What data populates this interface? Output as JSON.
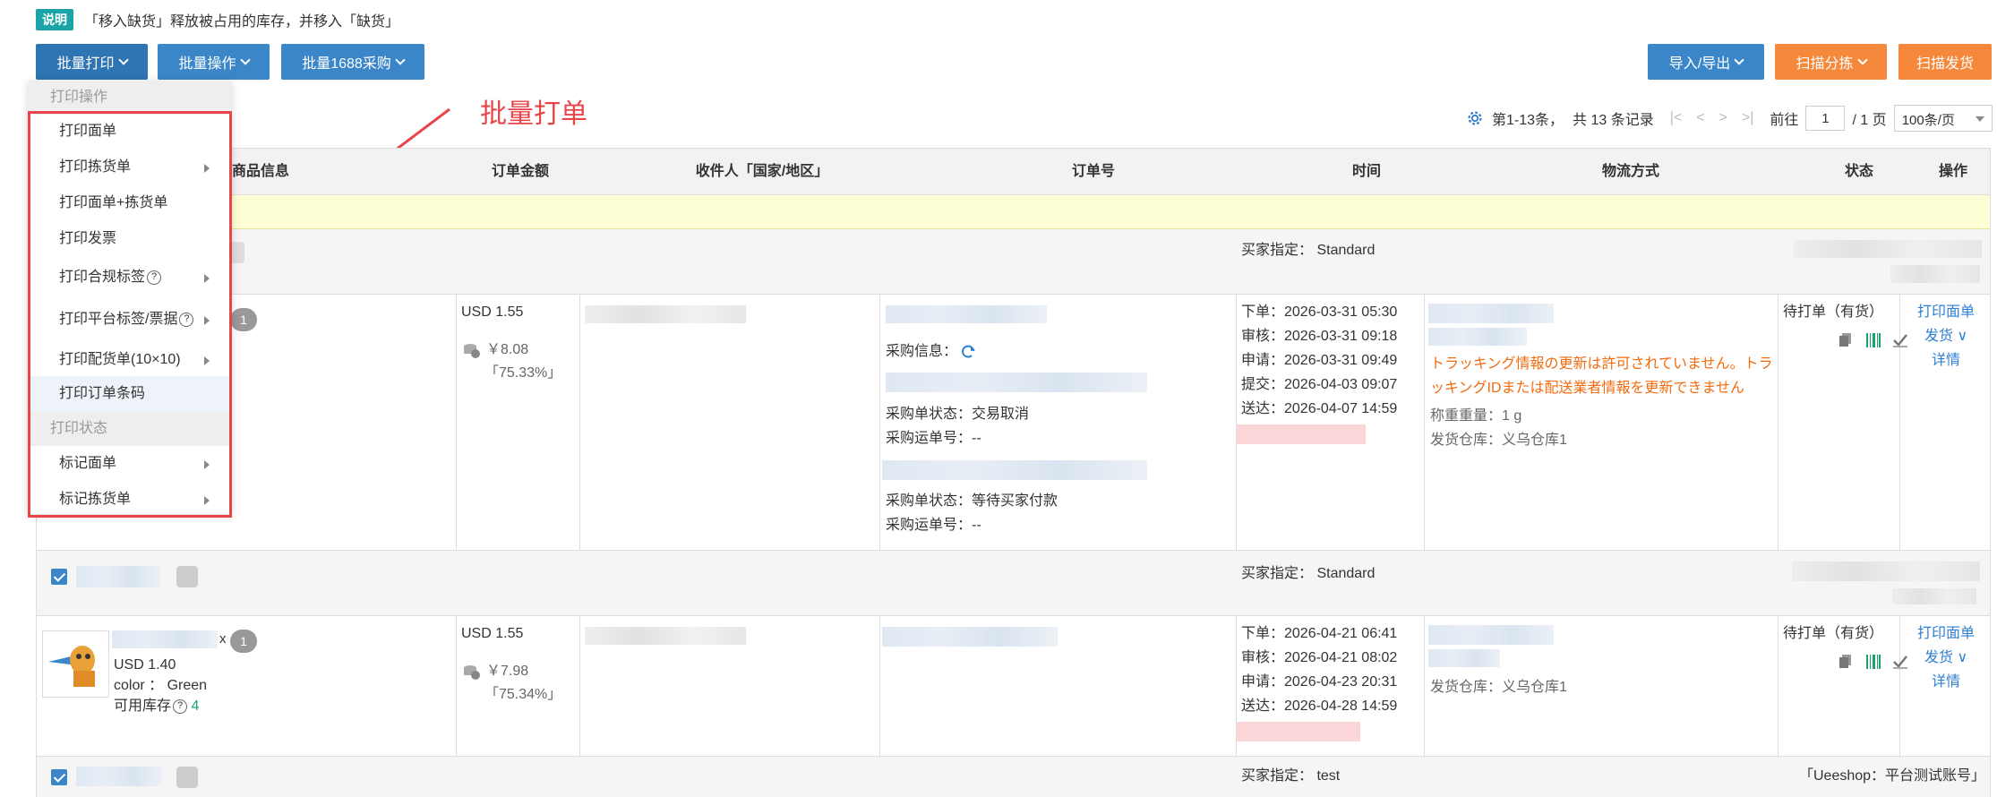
{
  "notice": {
    "tag": "说明",
    "text": "「移入缺货」释放被占用的库存，并移入「缺货」"
  },
  "toolbar": {
    "batch_print": "批量打印",
    "batch_ops": "批量操作",
    "batch_1688": "批量1688采购",
    "import_export": "导入/导出",
    "scan_sort": "扫描分拣",
    "scan_ship": "扫描发货"
  },
  "annotation": "批量打单",
  "pager": {
    "range": "第1-13条，",
    "total": "共 13 条记录",
    "goto_label": "前往",
    "page": "1",
    "pages": "/ 1 页",
    "per_page": "100条/页"
  },
  "columns": [
    "商品信息",
    "订单金额",
    "收件人「国家/地区」",
    "订单号",
    "时间",
    "物流方式",
    "状态",
    "操作"
  ],
  "dropdown": {
    "header1": "打印操作",
    "items1": [
      "打印面单",
      "打印拣货单",
      "打印面单+拣货单",
      "打印发票",
      "打印合规标签",
      "打印平台标签/票据",
      "打印配货单(10×10)",
      "打印订单条码"
    ],
    "header2": "打印状态",
    "items2": [
      "标记面单",
      "标记拣货单"
    ],
    "help": "?"
  },
  "orders": [
    {
      "group_buyer": "买家指定：  Standard",
      "qty": "1",
      "amount": "USD 1.55",
      "cost": "￥8.08",
      "margin": "「75.33%」",
      "purchase_label": "采购信息：",
      "p1_status": "采购单状态：交易取消",
      "p1_track": "采购运单号：--",
      "p2_status": "采购单状态：等待买家付款",
      "p2_track": "采购运单号：--",
      "times": [
        "下单：2026-03-31 05:30",
        "审核：2026-03-31 09:18",
        "申请：2026-03-31 09:49",
        "提交：2026-04-03 09:07",
        "送达：2026-04-07 14:59"
      ],
      "logistics_warning": "トラッキング情報の更新は許可されていません。トラッキングIDまたは配送業者情報を更新できません",
      "weight": "称重重量：1 g",
      "warehouse": "发货仓库：义乌仓库1",
      "status": "待打单（有货）",
      "ops": [
        "打印面单",
        "发货 ∨",
        "详情"
      ]
    },
    {
      "group_buyer": "买家指定：  Standard",
      "qty": "1",
      "x": "x",
      "price": "USD 1.40",
      "color": "color ：  Green",
      "stock_label": "可用库存",
      "stock_value": "4",
      "amount": "USD 1.55",
      "cost": "￥7.98",
      "margin": "「75.34%」",
      "times": [
        "下单：2026-04-21 06:41",
        "审核：2026-04-21 08:02",
        "申请：2026-04-23 20:31",
        "送达：2026-04-28 14:59"
      ],
      "warehouse": "发货仓库：义乌仓库1",
      "status": "待打单（有货）",
      "ops": [
        "打印面单",
        "发货 ∨",
        "详情"
      ]
    }
  ],
  "footer_group": {
    "buyer": "买家指定：  test",
    "shop": "「Ueeshop：平台测试账号」"
  },
  "colors": {
    "primary": "#3a86c9",
    "orange": "#f5883b",
    "warning": "#f26b0f",
    "annotation": "#e8454a"
  }
}
